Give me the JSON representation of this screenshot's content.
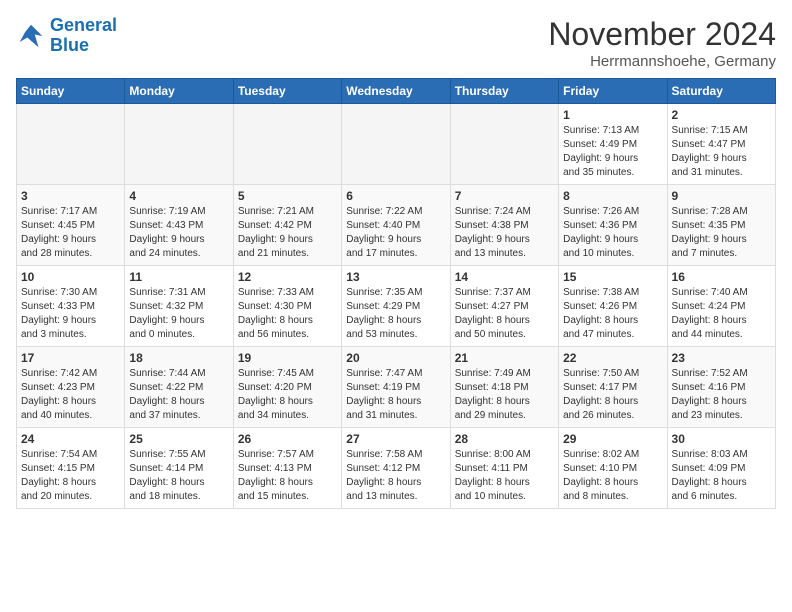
{
  "logo": {
    "line1": "General",
    "line2": "Blue"
  },
  "title": "November 2024",
  "location": "Herrmannshoehe, Germany",
  "headers": [
    "Sunday",
    "Monday",
    "Tuesday",
    "Wednesday",
    "Thursday",
    "Friday",
    "Saturday"
  ],
  "weeks": [
    [
      {
        "day": "",
        "info": ""
      },
      {
        "day": "",
        "info": ""
      },
      {
        "day": "",
        "info": ""
      },
      {
        "day": "",
        "info": ""
      },
      {
        "day": "",
        "info": ""
      },
      {
        "day": "1",
        "info": "Sunrise: 7:13 AM\nSunset: 4:49 PM\nDaylight: 9 hours\nand 35 minutes."
      },
      {
        "day": "2",
        "info": "Sunrise: 7:15 AM\nSunset: 4:47 PM\nDaylight: 9 hours\nand 31 minutes."
      }
    ],
    [
      {
        "day": "3",
        "info": "Sunrise: 7:17 AM\nSunset: 4:45 PM\nDaylight: 9 hours\nand 28 minutes."
      },
      {
        "day": "4",
        "info": "Sunrise: 7:19 AM\nSunset: 4:43 PM\nDaylight: 9 hours\nand 24 minutes."
      },
      {
        "day": "5",
        "info": "Sunrise: 7:21 AM\nSunset: 4:42 PM\nDaylight: 9 hours\nand 21 minutes."
      },
      {
        "day": "6",
        "info": "Sunrise: 7:22 AM\nSunset: 4:40 PM\nDaylight: 9 hours\nand 17 minutes."
      },
      {
        "day": "7",
        "info": "Sunrise: 7:24 AM\nSunset: 4:38 PM\nDaylight: 9 hours\nand 13 minutes."
      },
      {
        "day": "8",
        "info": "Sunrise: 7:26 AM\nSunset: 4:36 PM\nDaylight: 9 hours\nand 10 minutes."
      },
      {
        "day": "9",
        "info": "Sunrise: 7:28 AM\nSunset: 4:35 PM\nDaylight: 9 hours\nand 7 minutes."
      }
    ],
    [
      {
        "day": "10",
        "info": "Sunrise: 7:30 AM\nSunset: 4:33 PM\nDaylight: 9 hours\nand 3 minutes."
      },
      {
        "day": "11",
        "info": "Sunrise: 7:31 AM\nSunset: 4:32 PM\nDaylight: 9 hours\nand 0 minutes."
      },
      {
        "day": "12",
        "info": "Sunrise: 7:33 AM\nSunset: 4:30 PM\nDaylight: 8 hours\nand 56 minutes."
      },
      {
        "day": "13",
        "info": "Sunrise: 7:35 AM\nSunset: 4:29 PM\nDaylight: 8 hours\nand 53 minutes."
      },
      {
        "day": "14",
        "info": "Sunrise: 7:37 AM\nSunset: 4:27 PM\nDaylight: 8 hours\nand 50 minutes."
      },
      {
        "day": "15",
        "info": "Sunrise: 7:38 AM\nSunset: 4:26 PM\nDaylight: 8 hours\nand 47 minutes."
      },
      {
        "day": "16",
        "info": "Sunrise: 7:40 AM\nSunset: 4:24 PM\nDaylight: 8 hours\nand 44 minutes."
      }
    ],
    [
      {
        "day": "17",
        "info": "Sunrise: 7:42 AM\nSunset: 4:23 PM\nDaylight: 8 hours\nand 40 minutes."
      },
      {
        "day": "18",
        "info": "Sunrise: 7:44 AM\nSunset: 4:22 PM\nDaylight: 8 hours\nand 37 minutes."
      },
      {
        "day": "19",
        "info": "Sunrise: 7:45 AM\nSunset: 4:20 PM\nDaylight: 8 hours\nand 34 minutes."
      },
      {
        "day": "20",
        "info": "Sunrise: 7:47 AM\nSunset: 4:19 PM\nDaylight: 8 hours\nand 31 minutes."
      },
      {
        "day": "21",
        "info": "Sunrise: 7:49 AM\nSunset: 4:18 PM\nDaylight: 8 hours\nand 29 minutes."
      },
      {
        "day": "22",
        "info": "Sunrise: 7:50 AM\nSunset: 4:17 PM\nDaylight: 8 hours\nand 26 minutes."
      },
      {
        "day": "23",
        "info": "Sunrise: 7:52 AM\nSunset: 4:16 PM\nDaylight: 8 hours\nand 23 minutes."
      }
    ],
    [
      {
        "day": "24",
        "info": "Sunrise: 7:54 AM\nSunset: 4:15 PM\nDaylight: 8 hours\nand 20 minutes."
      },
      {
        "day": "25",
        "info": "Sunrise: 7:55 AM\nSunset: 4:14 PM\nDaylight: 8 hours\nand 18 minutes."
      },
      {
        "day": "26",
        "info": "Sunrise: 7:57 AM\nSunset: 4:13 PM\nDaylight: 8 hours\nand 15 minutes."
      },
      {
        "day": "27",
        "info": "Sunrise: 7:58 AM\nSunset: 4:12 PM\nDaylight: 8 hours\nand 13 minutes."
      },
      {
        "day": "28",
        "info": "Sunrise: 8:00 AM\nSunset: 4:11 PM\nDaylight: 8 hours\nand 10 minutes."
      },
      {
        "day": "29",
        "info": "Sunrise: 8:02 AM\nSunset: 4:10 PM\nDaylight: 8 hours\nand 8 minutes."
      },
      {
        "day": "30",
        "info": "Sunrise: 8:03 AM\nSunset: 4:09 PM\nDaylight: 8 hours\nand 6 minutes."
      }
    ]
  ]
}
